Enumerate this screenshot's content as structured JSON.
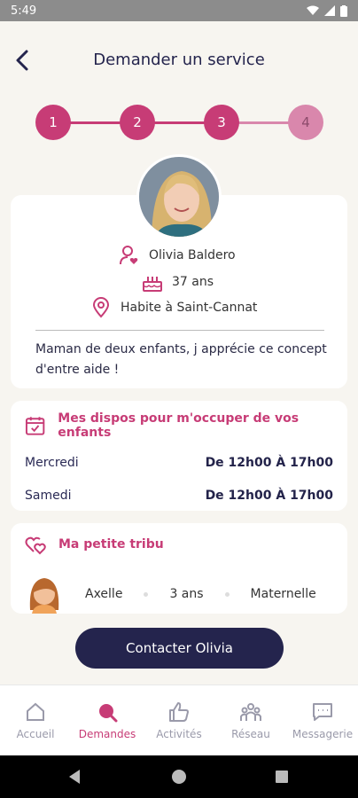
{
  "status": {
    "time": "5:49"
  },
  "header": {
    "title": "Demander un service"
  },
  "stepper": {
    "steps": [
      "1",
      "2",
      "3",
      "4"
    ]
  },
  "profile": {
    "name": "Olivia Baldero",
    "age": "37 ans",
    "location": "Habite à Saint-Cannat",
    "bio": "Maman de deux enfants, j apprécie ce concept d'entre aide !"
  },
  "dispos": {
    "title": "Mes dispos pour m'occuper de vos enfants",
    "rows": [
      {
        "day": "Mercredi",
        "time": "De 12h00 À 17h00"
      },
      {
        "day": "Samedi",
        "time": "De 12h00 À 17h00"
      }
    ]
  },
  "tribu": {
    "title": "Ma petite tribu",
    "kids": [
      {
        "name": "Axelle",
        "age": "3 ans",
        "school": "Maternelle"
      }
    ]
  },
  "cta": {
    "label": "Contacter Olivia"
  },
  "tabs": [
    {
      "label": "Accueil",
      "icon": "home-icon"
    },
    {
      "label": "Demandes",
      "icon": "search-icon"
    },
    {
      "label": "Activités",
      "icon": "thumbs-up-icon"
    },
    {
      "label": "Réseau",
      "icon": "people-icon"
    },
    {
      "label": "Messagerie",
      "icon": "chat-icon"
    }
  ],
  "colors": {
    "accent": "#c73c76",
    "primary": "#24244d",
    "background": "#f7f5f0"
  }
}
